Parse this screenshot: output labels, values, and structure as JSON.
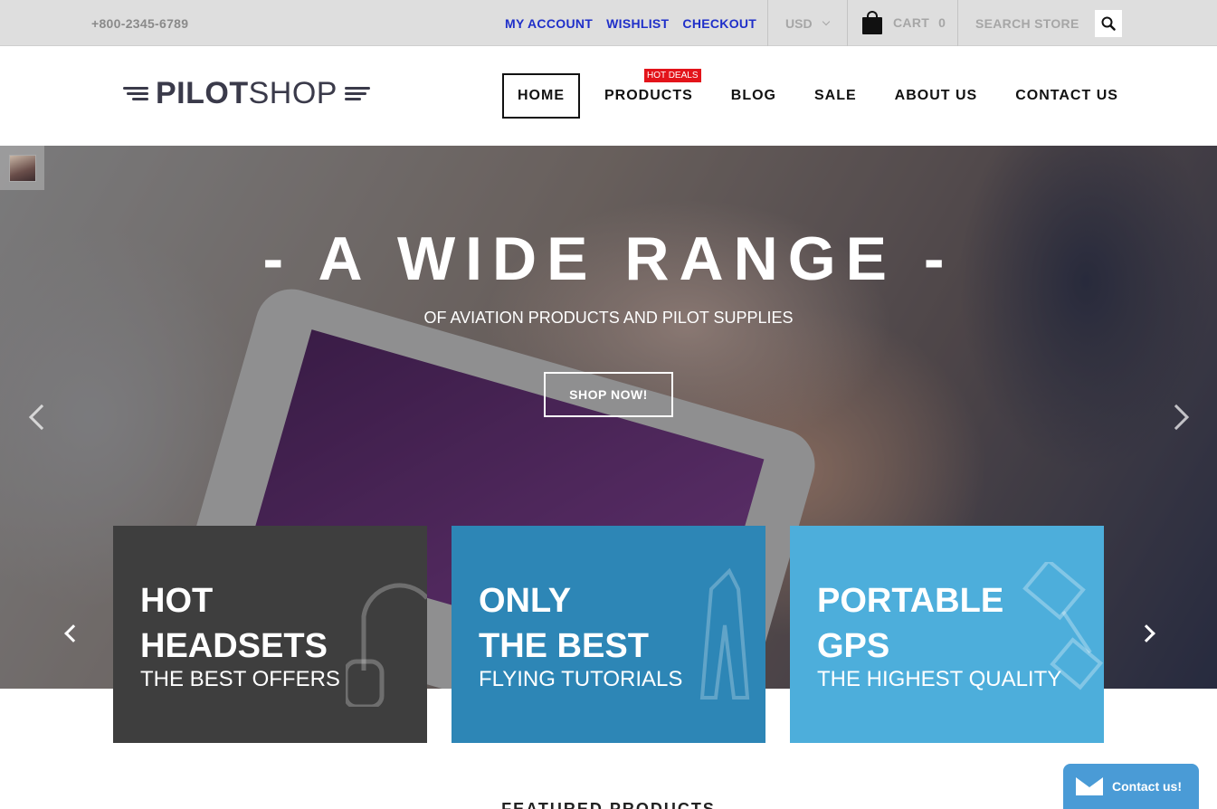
{
  "topbar": {
    "phone": "+800-2345-6789",
    "links": [
      "MY ACCOUNT",
      "WISHLIST",
      "CHECKOUT"
    ],
    "currency": "USD",
    "cart_label": "CART",
    "cart_count": "0",
    "search_placeholder": "SEARCH STORE",
    "link_color": "#1f2fc9"
  },
  "header": {
    "logo_bold": "PILOT",
    "logo_light": "SHOP",
    "nav": [
      "HOME",
      "PRODUCTS",
      "BLOG",
      "SALE",
      "ABOUT US",
      "CONTACT US"
    ],
    "active_nav": "HOME",
    "hot_badge": "HOT DEALS",
    "badge_color": "#e3141a"
  },
  "hero": {
    "title": "- A WIDE RANGE -",
    "subtitle": "OF AVIATION PRODUCTS AND PILOT SUPPLIES",
    "button": "SHOP NOW!"
  },
  "promos": [
    {
      "line1": "HOT",
      "line2": "HEADSETS",
      "line3": "THE BEST OFFERS",
      "color": "#3e3e3e",
      "icon": "headset-icon"
    },
    {
      "line1": "ONLY",
      "line2": "THE BEST",
      "line3": "FLYING TUTORIALS",
      "color": "#2d86b6",
      "icon": "flight-suit-icon"
    },
    {
      "line1": "PORTABLE",
      "line2": "GPS",
      "line3": "THE HIGHEST QUALITY",
      "color": "#4daedb",
      "icon": "satellite-icon"
    }
  ],
  "featured_title": "FEATURED PRODUCTS",
  "contact_widget": "Contact us!"
}
